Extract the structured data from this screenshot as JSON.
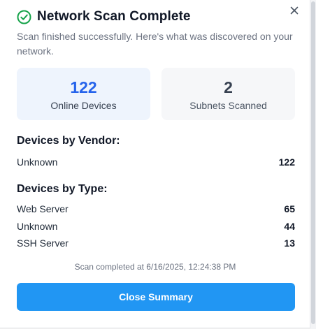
{
  "dialog": {
    "title": "Network Scan Complete",
    "subtitle": "Scan finished successfully. Here's what was discovered on your network.",
    "status_icon": "check-circle-icon",
    "close_icon": "close-icon"
  },
  "stats": {
    "online": {
      "value": "122",
      "label": "Online Devices"
    },
    "subnets": {
      "value": "2",
      "label": "Subnets Scanned"
    }
  },
  "vendor_section": {
    "heading": "Devices by Vendor:",
    "rows": [
      {
        "name": "Unknown",
        "count": "122"
      }
    ]
  },
  "type_section": {
    "heading": "Devices by Type:",
    "rows": [
      {
        "name": "Web Server",
        "count": "65"
      },
      {
        "name": "Unknown",
        "count": "44"
      },
      {
        "name": "SSH Server",
        "count": "13"
      }
    ]
  },
  "footer": {
    "completed_text": "Scan completed at 6/16/2025, 12:24:38 PM",
    "button_label": "Close Summary"
  },
  "colors": {
    "accent_blue": "#2563eb",
    "button_blue": "#2196f3",
    "success_green": "#16a34a"
  }
}
